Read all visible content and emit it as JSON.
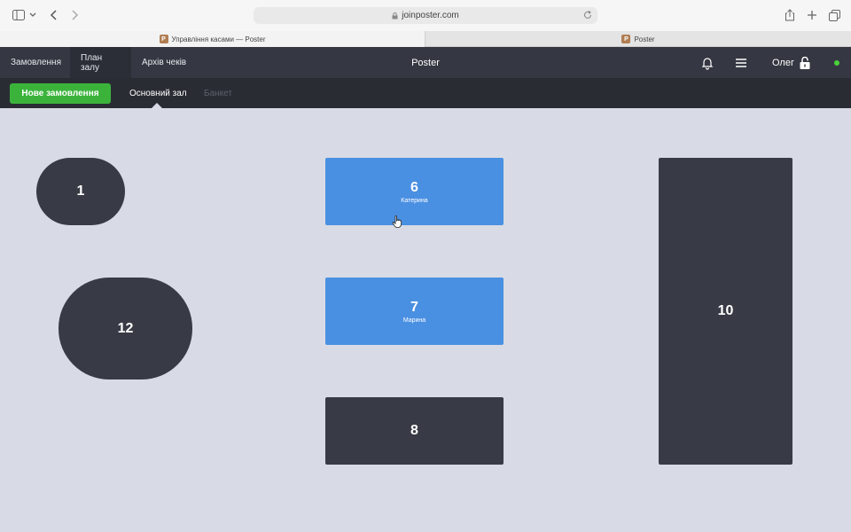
{
  "browser": {
    "url": "joinposter.com",
    "tabs": [
      {
        "label": "Управління касами — Poster",
        "favicon": "P"
      },
      {
        "label": "Poster",
        "favicon": "P"
      }
    ]
  },
  "app": {
    "title": "Poster",
    "nav": {
      "orders": "Замовлення",
      "floor_plan": "План залу",
      "receipts_archive": "Архів чеків"
    },
    "user": {
      "name": "Олег"
    },
    "online_status_color": "#4cd23a"
  },
  "subnav": {
    "new_order": "Нове замовлення",
    "halls": [
      {
        "label": "Основний зал",
        "active": true
      },
      {
        "label": "Банкет",
        "active": false
      }
    ]
  },
  "floor": {
    "tables": [
      {
        "number": "1",
        "waiter": "",
        "status": "free",
        "shape": "rounded"
      },
      {
        "number": "12",
        "waiter": "",
        "status": "free",
        "shape": "rounded"
      },
      {
        "number": "6",
        "waiter": "Катерина",
        "status": "busy",
        "shape": "rect"
      },
      {
        "number": "7",
        "waiter": "Марина",
        "status": "busy",
        "shape": "rect"
      },
      {
        "number": "8",
        "waiter": "",
        "status": "free",
        "shape": "rect"
      },
      {
        "number": "10",
        "waiter": "",
        "status": "free",
        "shape": "rect"
      }
    ]
  },
  "colors": {
    "header": "#353842",
    "subheader": "#2a2c34",
    "floor_bg": "#d8dbe5",
    "table_free": "#383b45",
    "table_busy": "#4a90e2",
    "primary_button": "#3bb33b"
  }
}
